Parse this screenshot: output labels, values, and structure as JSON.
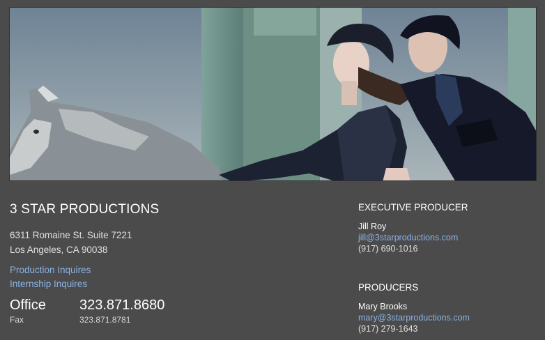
{
  "company": {
    "name": "3 STAR PRODUCTIONS",
    "address_line1": "6311 Romaine St. Suite 7221",
    "address_line2": "Los Angeles, CA 90038"
  },
  "links": {
    "production": "Production Inquires",
    "internship": "Internship Inquires"
  },
  "phones": {
    "office_label": "Office",
    "office_number": "323.871.8680",
    "fax_label": "Fax",
    "fax_number": "323.871.8781"
  },
  "contacts": [
    {
      "role": "EXECUTIVE PRODUCER",
      "name": "Jill Roy",
      "email": "jill@3starproductions.com",
      "phone": "(917) 690-1016"
    },
    {
      "role": "PRODUCERS",
      "name": "Mary Brooks",
      "email": "mary@3starproductions.com",
      "phone": "(917) 279-1643"
    }
  ],
  "colors": {
    "background": "#4b4b4b",
    "link": "#8ab3e6",
    "text": "#ffffff"
  }
}
